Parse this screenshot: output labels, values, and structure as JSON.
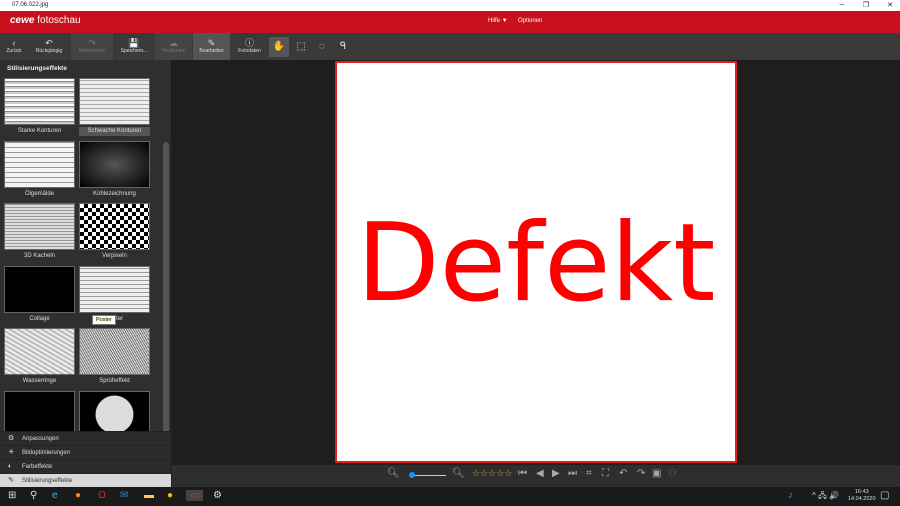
{
  "window": {
    "title": "07.06.022.jpg"
  },
  "header": {
    "brand": "cewe",
    "app": "fotoschau",
    "help": "Hilfe",
    "options": "Optionen"
  },
  "toolbar": {
    "items": [
      {
        "label": "Zurück",
        "icon": "‹"
      },
      {
        "label": "Rückgängig",
        "icon": "↶"
      },
      {
        "label": "Weiterleiten",
        "icon": "↷"
      },
      {
        "label": "Speichern...",
        "icon": "💾"
      },
      {
        "label": "Hochladen",
        "icon": "☁"
      },
      {
        "label": "Bearbeiten",
        "icon": "✎"
      },
      {
        "label": "Fotodaten",
        "icon": "ⓘ"
      }
    ]
  },
  "sidebar": {
    "heading": "Stilisierungseffekte",
    "effects": [
      "Starke Konturen",
      "Schwache Konturen",
      "Ölgemälde",
      "Kohlezeichnung",
      "3D Kacheln",
      "Verpixeln",
      "Collage",
      "Poster",
      "Wasserringe",
      "Sprüheffekt",
      "",
      ""
    ],
    "tooltip": "Poster",
    "panels": [
      "Anpassungen",
      "Bildoptimierungen",
      "Farbeffekte",
      "Stilisierungseffekte"
    ]
  },
  "photo": {
    "text": "Defekt"
  },
  "rating": {
    "stars": 0,
    "max": 5
  },
  "zoom": {
    "level": 0
  },
  "taskbar": {
    "time": "16:43",
    "date": "14.04.2020"
  }
}
